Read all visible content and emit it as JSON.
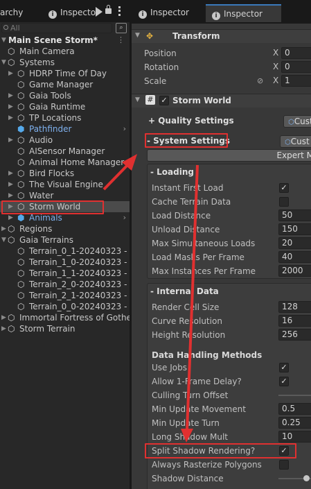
{
  "tabs": {
    "hierarchy": "archy",
    "inspector_a": "Inspecto",
    "inspector_b": "Inspector",
    "inspector_c": "Inspector",
    "info_icon": "i"
  },
  "search": {
    "placeholder": "All",
    "icon": "search-icon"
  },
  "hierarchy": {
    "scene": "Main Scene Storm*",
    "main_camera": "Main Camera",
    "systems": "Systems",
    "hdrp": "HDRP Time Of Day",
    "game_manager": "Game Manager",
    "gaia_tools": "Gaia Tools",
    "gaia_runtime": "Gaia Runtime",
    "tp_locations": "TP Locations",
    "pathfinder": "Pathfinder",
    "audio": "Audio",
    "aisensor": "AISensor Manager",
    "animal_home": "Animal Home Manager",
    "bird_flocks": "Bird Flocks",
    "visual_engine": "The Visual Engine",
    "water": "Water",
    "storm_world": "Storm World",
    "animals": "Animals",
    "regions": "Regions",
    "gaia_terrains": "Gaia Terrains",
    "t01": "Terrain_0_1-20240323 - 1",
    "t10": "Terrain_1_0-20240323 - 1",
    "t11": "Terrain_1_1-20240323 - 1",
    "t20": "Terrain_2_0-20240323 -",
    "t21": "Terrain_2_1-20240323 - 1",
    "t00": "Terrain_0_0-20240323 -",
    "immortal": "Immortal Fortress of Gother",
    "storm_terrain": "Storm Terrain"
  },
  "transform": {
    "title": "Transform",
    "position": "Position",
    "rotation": "Rotation",
    "scale": "Scale",
    "axis": "X",
    "pos_x": "0",
    "rot_x": "0",
    "scale_x": "1"
  },
  "storm": {
    "title": "Storm World",
    "quality": "+ Quality Settings",
    "system": "- System Settings",
    "custom": "Cust",
    "expert": "Expert M"
  },
  "loading": {
    "header": "- Loading",
    "instant": "Instant First Load",
    "cache": "Cache Terrain Data",
    "load_distance": "Load Distance",
    "load_distance_val": "50",
    "unload_distance": "Unload Distance",
    "unload_distance_val": "150",
    "max_sim": "Max Simultaneous Loads",
    "max_sim_val": "20",
    "load_masks": "Load Masks Per Frame",
    "load_masks_val": "40",
    "max_inst": "Max Instances Per Frame",
    "max_inst_val": "2000"
  },
  "internal": {
    "header": "- Internal Data",
    "cell_size": "Render Cell Size",
    "cell_size_val": "128",
    "curve_res": "Curve Resolution",
    "curve_res_val": "16",
    "height_res": "Height Resolution",
    "height_res_val": "256",
    "methods": "Data Handling Methods",
    "use_jobs": "Use Jobs",
    "allow_delay": "Allow 1-Frame Delay?",
    "culling": "Culling Turn Offset",
    "min_move": "Min Update Movement",
    "min_move_val": "0.5",
    "min_turn": "Min Update Turn",
    "min_turn_val": "0.25",
    "long_shadow": "Long Shadow Mult",
    "long_shadow_val": "10",
    "split_shadow": "Split Shadow Rendering?",
    "always_raster": "Always Rasterize Polygons",
    "shadow_dist": "Shadow Distance"
  },
  "checkmark": "✓",
  "colors": {
    "annotation": "#e03030",
    "selection": "#4b4b4b",
    "accent": "#3a79bb",
    "prefab_blue": "#7fb1ee"
  }
}
